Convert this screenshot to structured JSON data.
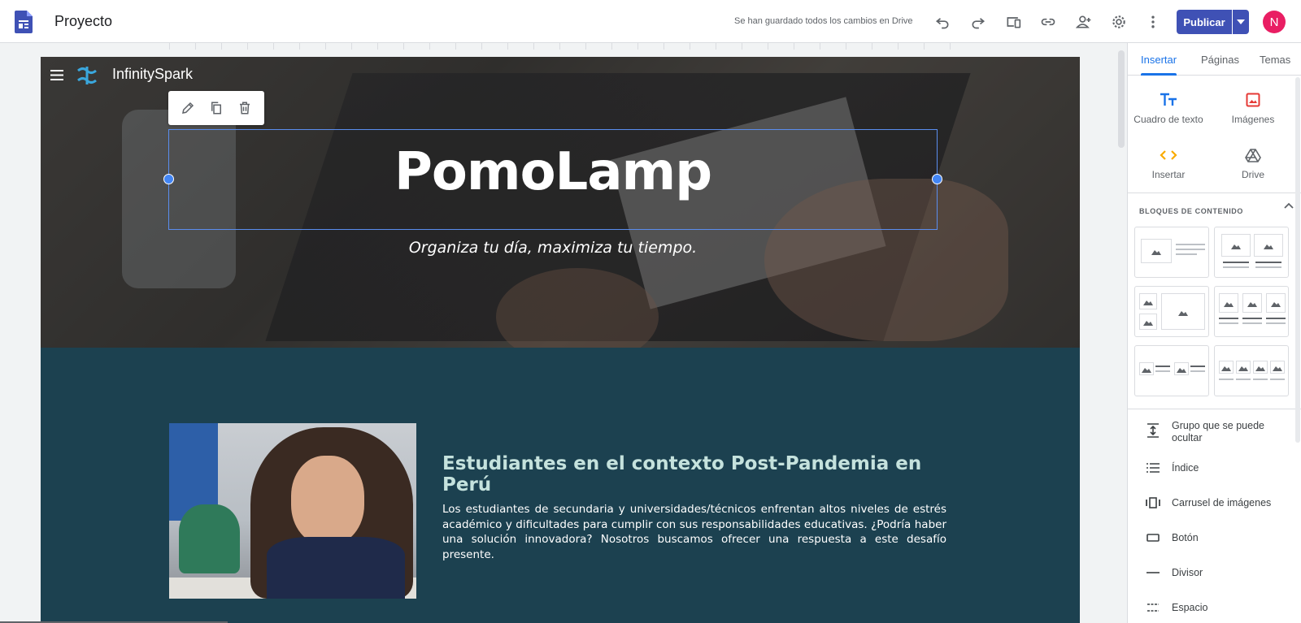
{
  "app": {
    "title": "Proyecto",
    "save_status": "Se han guardado todos los cambios en Drive",
    "publish_label": "Publicar",
    "avatar_initial": "N",
    "brand_color": "#3f51b5",
    "avatar_color": "#e91e63"
  },
  "toolbar_icons": [
    "undo-icon",
    "redo-icon",
    "preview-devices-icon",
    "link-icon",
    "share-person-icon",
    "settings-gear-icon",
    "more-vert-icon"
  ],
  "site": {
    "name": "InfinitySpark",
    "hero_title": "PomoLamp",
    "hero_subtitle": "Organiza tu día, maximiza tu tiempo.",
    "section_title": "Estudiantes en el contexto Post-Pandemia en Perú",
    "section_body": "Los estudiantes de secundaria y universidades/técnicos enfrentan altos niveles de estrés académico y dificultades para cumplir con sus responsabilidades educativas. ¿Podría haber una solución innovadora? Nosotros buscamos ofrecer una respuesta a este desafío presente.",
    "section_bg": "#1c4150",
    "section_title_color": "#c5e2dd"
  },
  "edit_toolbar": [
    "edit-pencil-icon",
    "duplicate-icon",
    "delete-icon"
  ],
  "panel": {
    "tabs": [
      {
        "label": "Insertar",
        "active": true
      },
      {
        "label": "Páginas",
        "active": false
      },
      {
        "label": "Temas",
        "active": false
      }
    ],
    "insert_items": [
      {
        "label": "Cuadro de texto",
        "icon": "text-box-icon"
      },
      {
        "label": "Imágenes",
        "icon": "image-icon"
      },
      {
        "label": "Insertar",
        "icon": "embed-code-icon"
      },
      {
        "label": "Drive",
        "icon": "drive-icon"
      }
    ],
    "blocks_heading": "BLOQUES DE CONTENIDO",
    "list_items": [
      {
        "label": "Grupo que se puede ocultar",
        "icon": "collapsible-group-icon"
      },
      {
        "label": "Índice",
        "icon": "table-of-contents-icon"
      },
      {
        "label": "Carrusel de imágenes",
        "icon": "image-carousel-icon"
      },
      {
        "label": "Botón",
        "icon": "button-icon"
      },
      {
        "label": "Divisor",
        "icon": "divider-icon"
      },
      {
        "label": "Espacio",
        "icon": "spacer-icon"
      }
    ]
  }
}
